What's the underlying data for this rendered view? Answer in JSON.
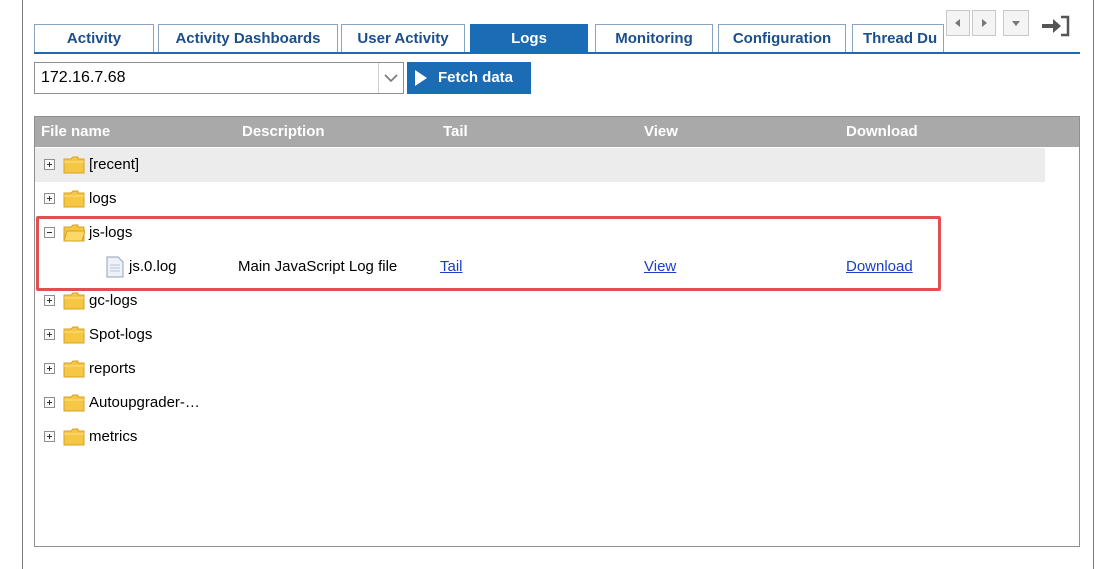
{
  "tabs": [
    {
      "label": "Activity",
      "active": false
    },
    {
      "label": "Activity Dashboards",
      "active": false
    },
    {
      "label": "User Activity",
      "active": false
    },
    {
      "label": "Logs",
      "active": true
    },
    {
      "label": "Monitoring",
      "active": false
    },
    {
      "label": "Configuration",
      "active": false
    },
    {
      "label": "Thread Du",
      "active": false
    }
  ],
  "toolbar": {
    "host_value": "172.16.7.68",
    "fetch_label": "Fetch data"
  },
  "grid": {
    "columns": [
      "File name",
      "Description",
      "Tail",
      "View",
      "Download"
    ],
    "rows": [
      {
        "type": "folder",
        "name": "[recent]",
        "expanded": false
      },
      {
        "type": "folder",
        "name": "logs",
        "expanded": false
      },
      {
        "type": "folder",
        "name": "js-logs",
        "expanded": true
      },
      {
        "type": "file",
        "name": "js.0.log",
        "description": "Main JavaScript Log file",
        "tail": "Tail",
        "view": "View",
        "download": "Download"
      },
      {
        "type": "folder",
        "name": "gc-logs",
        "expanded": false
      },
      {
        "type": "folder",
        "name": "Spot-logs",
        "expanded": false
      },
      {
        "type": "folder",
        "name": "reports",
        "expanded": false
      },
      {
        "type": "folder",
        "name": "Autoupgrader-…",
        "expanded": false
      },
      {
        "type": "folder",
        "name": "metrics",
        "expanded": false
      }
    ]
  },
  "colors": {
    "accent": "#1c6bb5",
    "header_bg": "#a9a9a9",
    "highlight": "#e05050",
    "link": "#1a3fc4"
  }
}
